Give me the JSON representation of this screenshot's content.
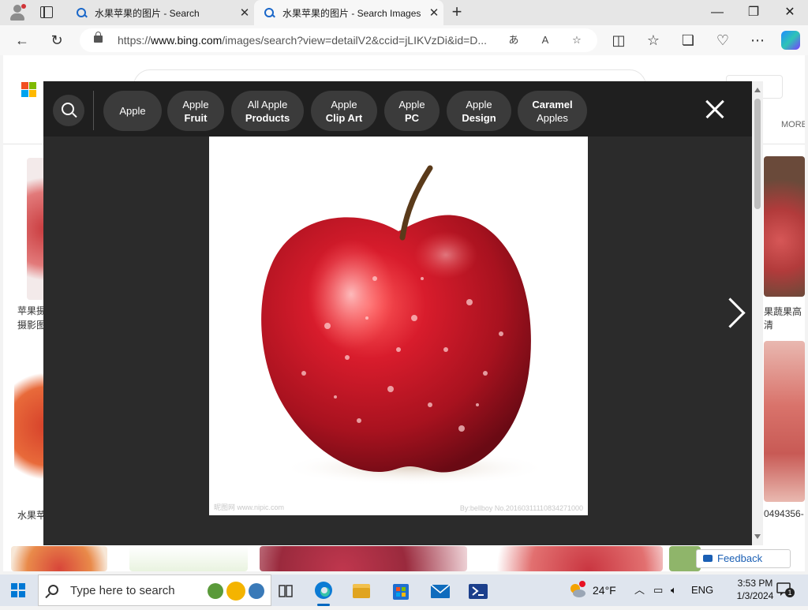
{
  "browser": {
    "tabs": [
      {
        "label": "水果苹果的图片 - Search"
      },
      {
        "label": "水果苹果的图片 - Search Images"
      }
    ],
    "url_prefix": "https://",
    "url_host": "www.bing.com",
    "url_rest": "/images/search?view=detailV2&ccid=jLIKVzDi&id=D..."
  },
  "modal": {
    "chips": [
      {
        "line1": "Apple",
        "line2": ""
      },
      {
        "line1": "Apple",
        "line2": "Fruit"
      },
      {
        "line1": "All Apple",
        "line2": "Products"
      },
      {
        "line1": "Apple",
        "line2": "Clip Art"
      },
      {
        "line1": "Apple",
        "line2": "PC"
      },
      {
        "line1": "Apple",
        "line2": "Design"
      },
      {
        "line1": "Caramel",
        "line2": "Apples"
      }
    ],
    "photo_watermark_left": "昵图网 www.nipic.com",
    "photo_watermark_right": "By:bellboy No.20160311110834271000"
  },
  "background": {
    "header_more": "MORE",
    "caption_left_1a": "苹果摄",
    "caption_left_1b": "摄影图",
    "caption_right_1": "果蔬果高清",
    "caption_left_2": "水果苹",
    "caption_right_2": "0494356-",
    "feedback": "Feedback"
  },
  "taskbar": {
    "search_placeholder": "Type here to search",
    "weather": "24°F",
    "language": "ENG",
    "time": "3:53 PM",
    "date": "1/3/2024",
    "notifications": "1"
  }
}
